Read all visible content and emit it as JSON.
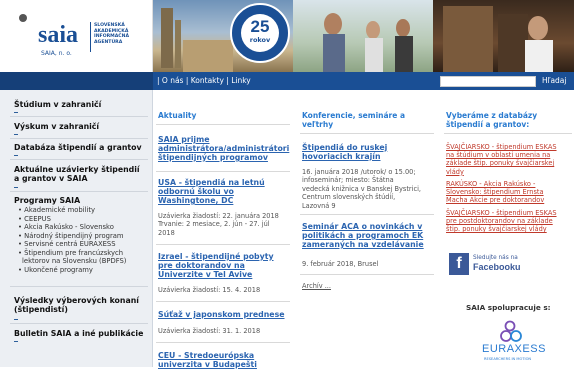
{
  "logo": {
    "name": "saia",
    "sub": "SAIA, n. o.",
    "tagline": [
      "SLOVENSKÁ",
      "AKADEMICKÁ",
      "INFORMAČNÁ",
      "AGENTÚRA"
    ]
  },
  "badge": {
    "number": "25",
    "unit": "rokov",
    "ring": "Slovenská akademická informačná agentúra"
  },
  "nav": {
    "links": "| O nás | Kontakty | Linky",
    "search_label": "Hľadaj"
  },
  "sidebar": {
    "items": [
      {
        "label": "Štúdium v zahraničí"
      },
      {
        "label": "Výskum v zahraničí"
      },
      {
        "label": "Databáza štipendií a grantov"
      },
      {
        "label": "Aktuálne uzávierky štipendií a grantov v SAIA"
      },
      {
        "label": "Programy SAIA"
      },
      {
        "label": "Výsledky výberových konaní (štipendistí)"
      },
      {
        "label": "Bulletin SAIA a iné publikácie"
      }
    ],
    "programs": [
      "• Akademické mobility",
      "• CEEPUS",
      "• Akcia Rakúsko - Slovensko",
      "• Národný štipendijný program",
      "• Servisné centrá EURAXESS",
      "• Štipendium pre francúzskych",
      "lektorov na Slovensku (BPDFS)",
      "• Ukončené programy"
    ]
  },
  "news": {
    "heading": "Aktuality",
    "articles": [
      {
        "title": [
          "SAIA prijme",
          "administrátora/administrátori",
          "štipendijných programov"
        ]
      },
      {
        "title": [
          "USA - štipendiá na letnú",
          "odbornú školu vo",
          "Washingtone, DC"
        ],
        "meta": [
          "Uzávierka žiadostí: 22. januára 2018",
          "Trvanie: 2 mesiace, 2. jún - 27. júl",
          "2018"
        ]
      },
      {
        "title": [
          "Izrael - štipendijné pobyty",
          "pre doktorandov na",
          "Univerzite v Tel Avive"
        ],
        "meta": [
          "Uzávierka žiadostí: 15. 4. 2018"
        ]
      },
      {
        "title": [
          "Súťaž v japonskom prednese"
        ],
        "meta": [
          "Uzávierka žiadostí: 31. 1. 2018"
        ]
      },
      {
        "title": [
          "CEU - Stredoeurópska",
          "univerzita v Budapešti"
        ]
      }
    ]
  },
  "events": {
    "heading": [
      "Konferencie, semináre a",
      "veľtrhy"
    ],
    "articles": [
      {
        "title": [
          "Štipendiá do ruskej",
          "hovoriacich krajín"
        ],
        "meta": [
          "16. januára 2018 /utorok/ o 15.00;",
          "infoseminár; miesto: Štátna",
          "vedecká knižnica v Banskej Bystrici,",
          "Centrum slovenských štúdií,",
          "Lazovná 9"
        ]
      },
      {
        "title": [
          "Seminár ACA o novinkách v",
          "politikách a programoch EK",
          "zameraných na vzdelávanie"
        ],
        "meta": [
          "9. február 2018, Brusel"
        ]
      }
    ],
    "archive": "Archív ..."
  },
  "right": {
    "heading": [
      "Vyberáme z databázy",
      "štipendií a grantov:"
    ],
    "links": [
      [
        "ŠVAJČIARSKO - štipendium ESKAS",
        "na štúdium v oblasti umenia na",
        "základe štip. ponuky švajčiarskej",
        "vlády"
      ],
      [
        "RAKÚSKO - Akcia Rakúsko -",
        "Slovensko: štipendium Ernsta",
        "Macha Akcie pre doktorandov"
      ],
      [
        "ŠVAJČIARSKO - štipendium ESKAS",
        "pre postdoktorandov na základe",
        "štip. ponuky švajčiarskej vlády"
      ]
    ],
    "facebook": [
      "Sledujte nás na",
      "Facebooku"
    ],
    "partners": "SAIA spolupracuje s:",
    "euraxess": "EURAXESS",
    "euraxess_sub": "RESEARCHERS IN MOTION"
  }
}
